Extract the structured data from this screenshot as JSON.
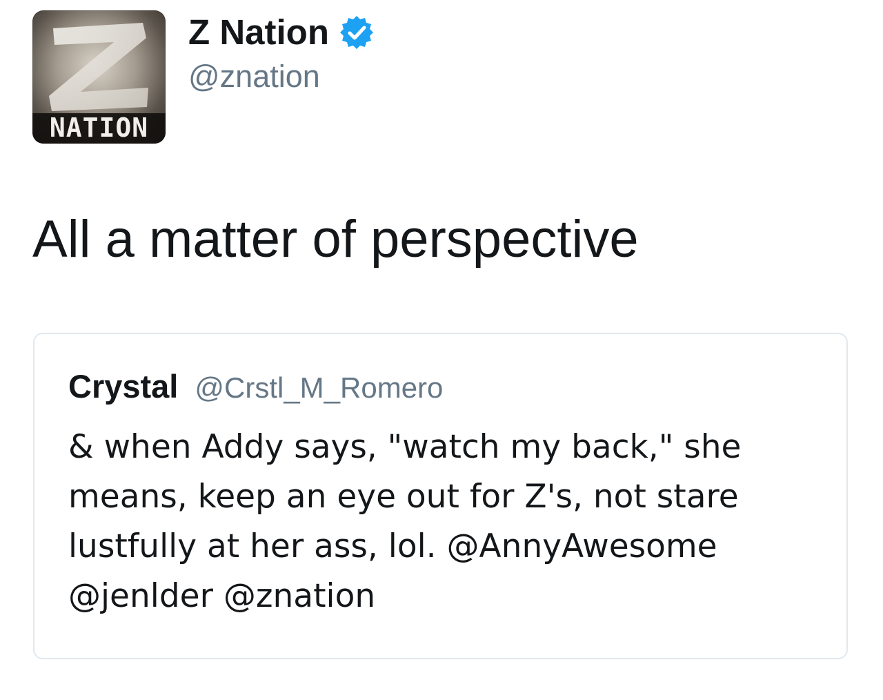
{
  "author": {
    "display_name": "Z Nation",
    "handle": "@znation",
    "avatar_label": "NATION",
    "avatar_letter": "Z",
    "verified_icon": "verified-badge-icon",
    "verified_color": "#1da1f2"
  },
  "tweet": {
    "text": "All a matter of perspective"
  },
  "quoted_tweet": {
    "display_name": "Crystal",
    "handle": "@Crstl_M_Romero",
    "lines": [
      "& when Addy says, \"watch my back,\" she",
      "means, keep an eye out for Z's, not stare",
      "lustfully at her ass, lol. @AnnyAwesome",
      "@jenlder @znation"
    ]
  },
  "colors": {
    "text_primary": "#14171a",
    "text_secondary": "#657786",
    "card_border": "#e1e8ed",
    "verified": "#1da1f2"
  }
}
